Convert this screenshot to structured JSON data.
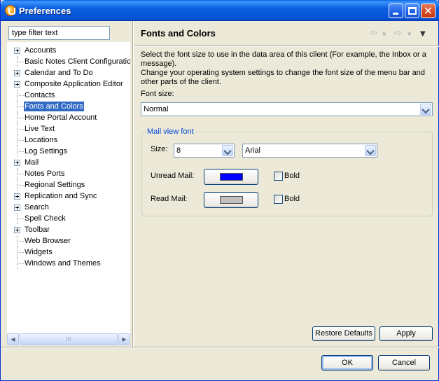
{
  "window": {
    "title": "Preferences"
  },
  "filter": {
    "value": "type filter text"
  },
  "tree": {
    "items": [
      {
        "label": "Accounts",
        "expandable": true,
        "selected": false
      },
      {
        "label": "Basic Notes Client Configuration",
        "expandable": false,
        "selected": false
      },
      {
        "label": "Calendar and To Do",
        "expandable": true,
        "selected": false
      },
      {
        "label": "Composite Application Editor",
        "expandable": true,
        "selected": false
      },
      {
        "label": "Contacts",
        "expandable": false,
        "selected": false
      },
      {
        "label": "Fonts and Colors",
        "expandable": false,
        "selected": true
      },
      {
        "label": "Home Portal Account",
        "expandable": false,
        "selected": false
      },
      {
        "label": "Live Text",
        "expandable": false,
        "selected": false
      },
      {
        "label": "Locations",
        "expandable": false,
        "selected": false
      },
      {
        "label": "Log Settings",
        "expandable": false,
        "selected": false
      },
      {
        "label": "Mail",
        "expandable": true,
        "selected": false
      },
      {
        "label": "Notes Ports",
        "expandable": false,
        "selected": false
      },
      {
        "label": "Regional Settings",
        "expandable": false,
        "selected": false
      },
      {
        "label": "Replication and Sync",
        "expandable": true,
        "selected": false
      },
      {
        "label": "Search",
        "expandable": true,
        "selected": false
      },
      {
        "label": "Spell Check",
        "expandable": false,
        "selected": false
      },
      {
        "label": "Toolbar",
        "expandable": true,
        "selected": false
      },
      {
        "label": "Web Browser",
        "expandable": false,
        "selected": false
      },
      {
        "label": "Widgets",
        "expandable": false,
        "selected": false
      },
      {
        "label": "Windows and Themes",
        "expandable": false,
        "selected": false
      }
    ],
    "scroll_thumb_glyph": "III"
  },
  "page": {
    "title": "Fonts and Colors",
    "description_line1": "Select the font size to use in the data area of this client (For example, the Inbox or a message).",
    "description_line2": "Change your operating system settings to change the font size of the menu bar and other parts of the client.",
    "font_size_label": "Font size:",
    "font_size_value": "Normal",
    "mail_view_group_title": "Mail view font",
    "size_label": "Size:",
    "size_value": "8",
    "font_value": "Arial",
    "unread_mail_label": "Unread Mail:",
    "unread_mail_color": "#0000ff",
    "unread_bold_label": "Bold",
    "unread_bold_checked": false,
    "read_mail_label": "Read Mail:",
    "read_mail_color": "#c0c0c0",
    "read_bold_label": "Bold",
    "read_bold_checked": false,
    "restore_defaults_label": "Restore Defaults",
    "apply_label": "Apply"
  },
  "dialog": {
    "ok_label": "OK",
    "cancel_label": "Cancel"
  },
  "icons": {
    "back": "back-arrow-icon",
    "forward": "forward-arrow-icon",
    "menu": "view-menu-icon"
  }
}
